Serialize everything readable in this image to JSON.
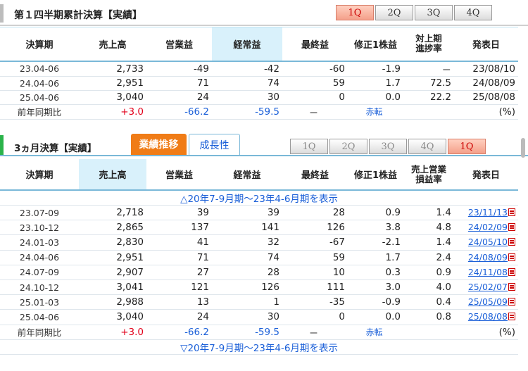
{
  "section1": {
    "title": "第１四半期累計決算【実績】",
    "tabs": [
      {
        "label": "1Q",
        "active": true
      },
      {
        "label": "2Q",
        "active": false
      },
      {
        "label": "3Q",
        "active": false
      },
      {
        "label": "4Q",
        "active": false
      }
    ],
    "headers": {
      "period": "決算期",
      "sales": "売上高",
      "op": "営業益",
      "ordinary": "経常益",
      "net": "最終益",
      "eps": "修正1株益",
      "progress1": "対上期",
      "progress2": "進捗率",
      "date": "発表日"
    },
    "rows": [
      {
        "period": "23.04-06",
        "sales": "2,733",
        "op": "-49",
        "ordinary": "-42",
        "net": "-60",
        "eps": "-1.9",
        "progress": "－",
        "date": "23/08/10"
      },
      {
        "period": "24.04-06",
        "sales": "2,951",
        "op": "71",
        "ordinary": "74",
        "net": "59",
        "eps": "1.7",
        "progress": "72.5",
        "date": "24/08/09"
      },
      {
        "period": "25.04-06",
        "sales": "3,040",
        "op": "24",
        "ordinary": "30",
        "net": "0",
        "eps": "0.0",
        "progress": "22.2",
        "date": "25/08/08"
      }
    ],
    "yoy": {
      "label": "前年同期比",
      "sales": "+3.0",
      "op": "-66.2",
      "ordinary": "-59.5",
      "net": "－",
      "eps": "赤転",
      "unit": "(%)"
    }
  },
  "section2": {
    "title": "3ヵ月決算【実績】",
    "btn_results": "業績推移",
    "btn_growth": "成長性",
    "tabs": [
      {
        "label": "1Q",
        "active": false
      },
      {
        "label": "2Q",
        "active": false
      },
      {
        "label": "3Q",
        "active": false
      },
      {
        "label": "4Q",
        "active": false
      },
      {
        "label": "1Q",
        "active": true
      }
    ],
    "headers": {
      "period": "決算期",
      "sales": "売上高",
      "op": "営業益",
      "ordinary": "経常益",
      "net": "最終益",
      "eps": "修正1株益",
      "margin1": "売上営業",
      "margin2": "損益率",
      "date": "発表日"
    },
    "show_prev": "△20年7-9月期～23年4-6月期を表示",
    "show_next": "▽20年7-9月期～23年4-6月期を表示",
    "rows": [
      {
        "period": "23.07-09",
        "sales": "2,718",
        "op": "39",
        "ordinary": "39",
        "net": "28",
        "eps": "0.9",
        "margin": "1.4",
        "date": "23/11/13"
      },
      {
        "period": "23.10-12",
        "sales": "2,865",
        "op": "137",
        "ordinary": "141",
        "net": "126",
        "eps": "3.8",
        "margin": "4.8",
        "date": "24/02/09"
      },
      {
        "period": "24.01-03",
        "sales": "2,830",
        "op": "41",
        "ordinary": "32",
        "net": "-67",
        "eps": "-2.1",
        "margin": "1.4",
        "date": "24/05/10"
      },
      {
        "period": "24.04-06",
        "sales": "2,951",
        "op": "71",
        "ordinary": "74",
        "net": "59",
        "eps": "1.7",
        "margin": "2.4",
        "date": "24/08/09"
      },
      {
        "period": "24.07-09",
        "sales": "2,907",
        "op": "27",
        "ordinary": "28",
        "net": "10",
        "eps": "0.3",
        "margin": "0.9",
        "date": "24/11/08"
      },
      {
        "period": "24.10-12",
        "sales": "3,041",
        "op": "121",
        "ordinary": "126",
        "net": "111",
        "eps": "3.0",
        "margin": "4.0",
        "date": "25/02/07"
      },
      {
        "period": "25.01-03",
        "sales": "2,988",
        "op": "13",
        "ordinary": "1",
        "net": "-35",
        "eps": "-0.9",
        "margin": "0.4",
        "date": "25/05/09"
      },
      {
        "period": "25.04-06",
        "sales": "3,040",
        "op": "24",
        "ordinary": "30",
        "net": "0",
        "eps": "0.0",
        "margin": "0.8",
        "date": "25/08/08"
      }
    ],
    "yoy": {
      "label": "前年同期比",
      "sales": "+3.0",
      "op": "-66.2",
      "ordinary": "-59.5",
      "net": "－",
      "eps": "赤転",
      "unit": "(%)"
    }
  },
  "colors": {
    "accent_orange": "#f07c17",
    "header_blue": "#d9f1fb",
    "positive_red": "#e2001a",
    "negative_blue": "#1a5fd8",
    "section_green": "#2ab34a"
  }
}
